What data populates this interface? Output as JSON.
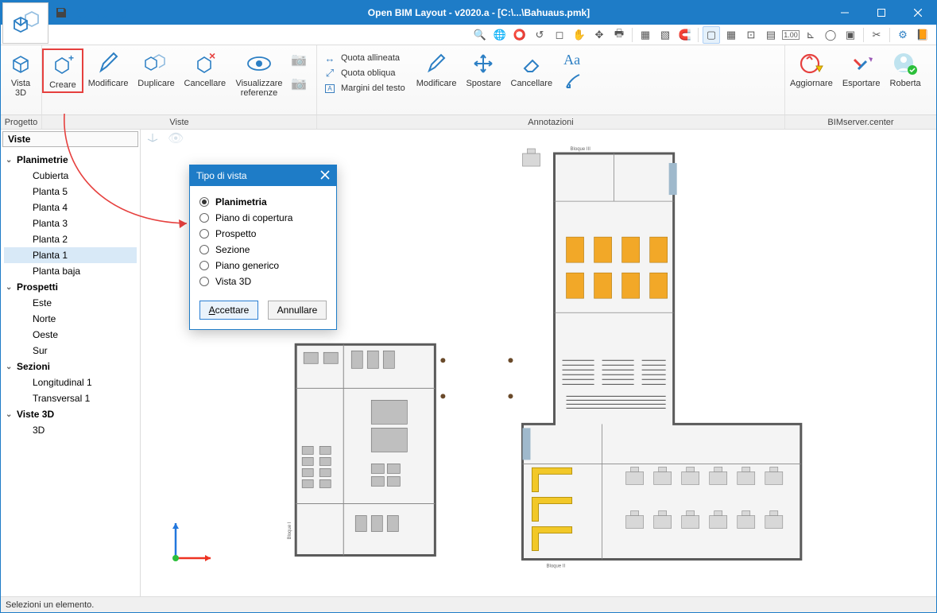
{
  "title": "Open BIM Layout - v2020.a - [C:\\...\\Bahuaus.pmk]",
  "ribbon": {
    "vista3d": "Vista\n3D",
    "creare": "Creare",
    "modificare": "Modificare",
    "duplicare": "Duplicare",
    "cancellare": "Cancellare",
    "visualizzare": "Visualizzare\nreferenze",
    "ann_quota_allineata": "Quota allineata",
    "ann_quota_obliqua": "Quota obliqua",
    "ann_margini": "Margini del testo",
    "ann_modificare": "Modificare",
    "ann_spostare": "Spostare",
    "ann_cancellare": "Cancellare",
    "aggiornare": "Aggiornare",
    "esportare": "Esportare",
    "roberta": "Roberta"
  },
  "groups": {
    "progetto": "Progetto",
    "viste": "Viste",
    "annotazioni": "Annotazioni",
    "bimserver": "BIMserver.center"
  },
  "sidebar": {
    "header": "Viste",
    "sections": [
      {
        "label": "Planimetrie",
        "items": [
          "Cubierta",
          "Planta 5",
          "Planta 4",
          "Planta 3",
          "Planta 2",
          "Planta 1",
          "Planta baja"
        ],
        "selected": "Planta 1"
      },
      {
        "label": "Prospetti",
        "items": [
          "Este",
          "Norte",
          "Oeste",
          "Sur"
        ]
      },
      {
        "label": "Sezioni",
        "items": [
          "Longitudinal 1",
          "Transversal 1"
        ]
      },
      {
        "label": "Viste 3D",
        "items": [
          "3D"
        ]
      }
    ]
  },
  "dialog": {
    "title": "Tipo di vista",
    "options": [
      "Planimetria",
      "Piano di copertura",
      "Prospetto",
      "Sezione",
      "Piano generico",
      "Vista 3D"
    ],
    "selected": "Planimetria",
    "accept": "Accettare",
    "cancel": "Annullare"
  },
  "canvas_labels": {
    "bloque1": "Bloque I",
    "bloque2": "Bloque II",
    "bloque3": "Bloque III"
  },
  "status": "Selezioni un elemento."
}
